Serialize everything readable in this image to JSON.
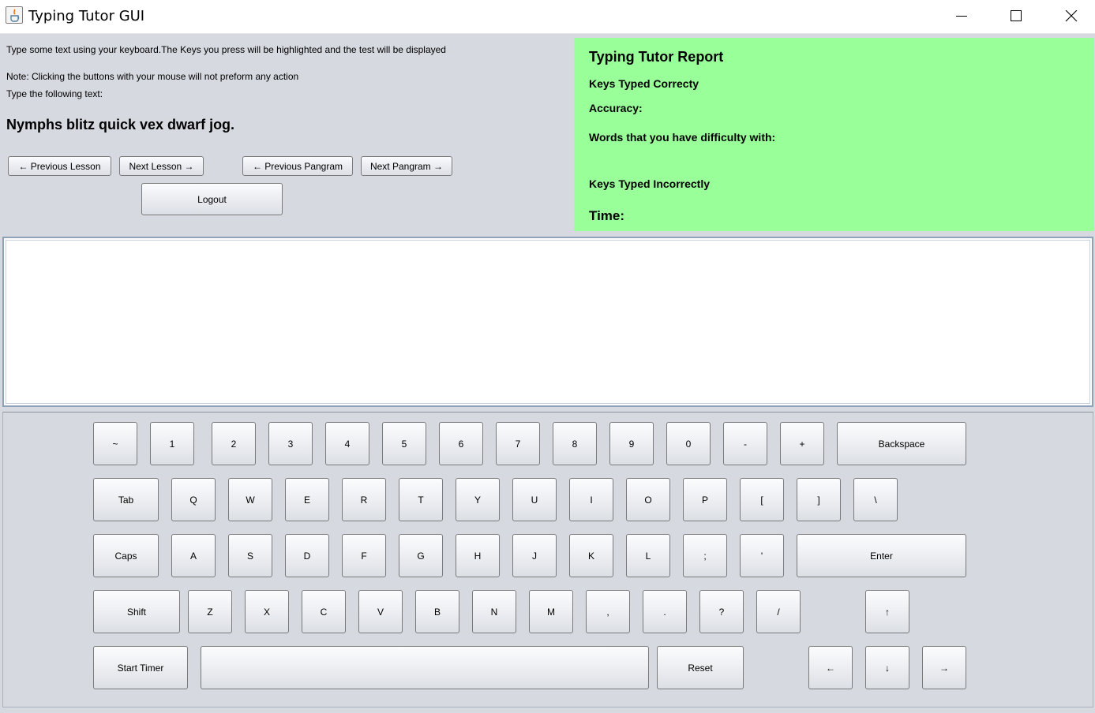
{
  "window": {
    "title": "Typing Tutor GUI",
    "controls": [
      "minimize",
      "maximize",
      "close"
    ]
  },
  "instructions": {
    "line1": "Type some text using your keyboard.The Keys you press will be highlighted and the test will be displayed",
    "line2": "Note: Clicking the buttons with your mouse will not preform any action",
    "line3": "Type the following text:",
    "pangram": "Nymphs blitz quick vex dwarf jog."
  },
  "nav": {
    "prev_lesson": "← Previous Lesson",
    "next_lesson": "Next Lesson →",
    "prev_pangram": "← Previous Pangram",
    "next_pangram": "Next Pangram →",
    "logout": "Logout"
  },
  "report": {
    "title": "Typing Tutor Report",
    "keys_correct": "Keys Typed Correcty",
    "accuracy": "Accuracy:",
    "difficulty": "Words that you have difficulty with:",
    "keys_incorrect": "Keys Typed Incorrectly",
    "time": "Time:",
    "background": "#99ff99"
  },
  "typing_area": {
    "value": ""
  },
  "keyboard": {
    "row1": [
      "~",
      "1",
      "2",
      "3",
      "4",
      "5",
      "6",
      "7",
      "8",
      "9",
      "0",
      "-",
      "+",
      "Backspace"
    ],
    "row2": [
      "Tab",
      "Q",
      "W",
      "E",
      "R",
      "T",
      "Y",
      "U",
      "I",
      "O",
      "P",
      "[",
      "]",
      "\\"
    ],
    "row3": [
      "Caps",
      "A",
      "S",
      "D",
      "F",
      "G",
      "H",
      "J",
      "K",
      "L",
      ";",
      "'",
      "Enter"
    ],
    "row4": [
      "Shift",
      "Z",
      "X",
      "C",
      "V",
      "B",
      "N",
      "M",
      ",",
      ".",
      "?",
      "/",
      "↑"
    ],
    "row5": [
      "Start Timer",
      "",
      "Reset",
      "←",
      "↓",
      "→"
    ]
  }
}
